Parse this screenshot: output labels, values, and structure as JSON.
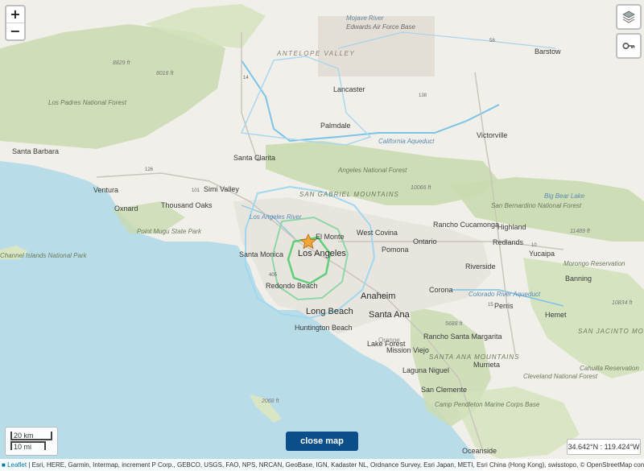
{
  "map": {
    "cities": [
      {
        "id": "lancaster",
        "name": "Lancaster"
      },
      {
        "id": "palmdale",
        "name": "Palmdale"
      },
      {
        "id": "victorville",
        "name": "Victorville"
      },
      {
        "id": "barstow",
        "name": "Barstow"
      },
      {
        "id": "santa-barbara",
        "name": "Santa Barbara"
      },
      {
        "id": "santa-clarita",
        "name": "Santa Clarita"
      },
      {
        "id": "simi-valley",
        "name": "Simi Valley"
      },
      {
        "id": "ventura",
        "name": "Ventura"
      },
      {
        "id": "oxnard",
        "name": "Oxnard"
      },
      {
        "id": "thousand-oaks",
        "name": "Thousand Oaks"
      },
      {
        "id": "los-angeles",
        "name": "Los Angeles"
      },
      {
        "id": "el-monte",
        "name": "El Monte"
      },
      {
        "id": "west-covina",
        "name": "West Covina"
      },
      {
        "id": "pomona",
        "name": "Pomona"
      },
      {
        "id": "ontario",
        "name": "Ontario"
      },
      {
        "id": "rancho-cucamonga",
        "name": "Rancho Cucamonga"
      },
      {
        "id": "highland",
        "name": "Highland"
      },
      {
        "id": "redlands",
        "name": "Redlands"
      },
      {
        "id": "yucaipa",
        "name": "Yucaipa"
      },
      {
        "id": "riverside",
        "name": "Riverside"
      },
      {
        "id": "santa-monica",
        "name": "Santa Monica"
      },
      {
        "id": "redondo-beach",
        "name": "Redondo Beach"
      },
      {
        "id": "long-beach",
        "name": "Long Beach"
      },
      {
        "id": "anaheim",
        "name": "Anaheim"
      },
      {
        "id": "santa-ana",
        "name": "Santa Ana"
      },
      {
        "id": "corona",
        "name": "Corona"
      },
      {
        "id": "perris",
        "name": "Perris"
      },
      {
        "id": "hemet",
        "name": "Hemet"
      },
      {
        "id": "banning",
        "name": "Banning"
      },
      {
        "id": "huntington-beach",
        "name": "Huntington Beach"
      },
      {
        "id": "lake-forest",
        "name": "Lake Forest"
      },
      {
        "id": "mission-viejo",
        "name": "Mission Viejo"
      },
      {
        "id": "laguna-niguel",
        "name": "Laguna Niguel"
      },
      {
        "id": "san-clemente",
        "name": "San Clemente"
      },
      {
        "id": "oceanside",
        "name": "Oceanside"
      },
      {
        "id": "murrieta",
        "name": "Murrieta"
      },
      {
        "id": "rancho-santa-margarita",
        "name": "Rancho Santa Margarita"
      }
    ],
    "features": [
      {
        "id": "antelope-valley",
        "name": "ANTELOPE VALLEY"
      },
      {
        "id": "edwards",
        "name": "Edwards Air Force Base"
      },
      {
        "id": "mojave-river",
        "name": "Mojave River"
      },
      {
        "id": "san-gabriel-mtns",
        "name": "SAN GABRIEL MOUNTAINS"
      },
      {
        "id": "san-bernardino-forest",
        "name": "San Bernardino National Forest"
      },
      {
        "id": "angeles-forest",
        "name": "Angeles National Forest"
      },
      {
        "id": "los-padres-forest",
        "name": "Los Padres National Forest"
      },
      {
        "id": "cleveland-forest",
        "name": "Cleveland National Forest"
      },
      {
        "id": "channel-islands",
        "name": "Channel Islands National Park"
      },
      {
        "id": "point-mugu",
        "name": "Point Mugu State Park"
      },
      {
        "id": "camp-pendleton",
        "name": "Camp Pendleton Marine Corps Base"
      },
      {
        "id": "cahuilla",
        "name": "Cahuilla Reservation"
      },
      {
        "id": "morongo",
        "name": "Morongo Reservation"
      },
      {
        "id": "big-bear",
        "name": "Big Bear Lake"
      },
      {
        "id": "san-jacinto-mtns",
        "name": "SAN JACINTO MOUNTAINS"
      },
      {
        "id": "santa-ana-mtns",
        "name": "SANTA ANA MOUNTAINS"
      },
      {
        "id": "california-aqueduct",
        "name": "California Aqueduct"
      },
      {
        "id": "los-angeles-river",
        "name": "Los Angeles River"
      },
      {
        "id": "colorado-aqueduct",
        "name": "Colorado River Aqueduct"
      },
      {
        "id": "orange",
        "name": "Orange"
      }
    ],
    "elevations": [
      "8829 ft",
      "8016 ft",
      "10066 ft",
      "11489 ft",
      "5688 ft",
      "2068 ft",
      "10834 ft"
    ],
    "highways": [
      "58",
      "14",
      "5",
      "126",
      "101",
      "405",
      "10",
      "15",
      "138"
    ]
  },
  "controls": {
    "zoom_in": "+",
    "zoom_out": "−",
    "layers_icon": "layers-icon",
    "key_icon": "key-icon"
  },
  "scale": {
    "km": "20 km",
    "mi": "10 mi"
  },
  "close_button": "close map",
  "coordinates": "34.642°N : 119.424°W",
  "attribution": {
    "leaflet": "Leaflet",
    "text": " | Esri, HERE, Garmin, Intermap, increment P Corp., GEBCO, USGS, FAO, NPS, NRCAN, GeoBase, IGN, Kadaster NL, Ordnance Survey, Esri Japan, METI, Esri China (Hong Kong), swisstopo, © OpenStreetMap contrib..."
  },
  "colors": {
    "ocean": "#b9dde8",
    "land": "#f1efe9",
    "forest": "#c9dbb0",
    "urban": "#e6e3dc",
    "contour_outer": "#9fd8ef",
    "contour_mid": "#8fd7a6",
    "contour_inner": "#5fcf7a",
    "epicenter": "#f3a43a",
    "button": "#0b4f8a"
  }
}
